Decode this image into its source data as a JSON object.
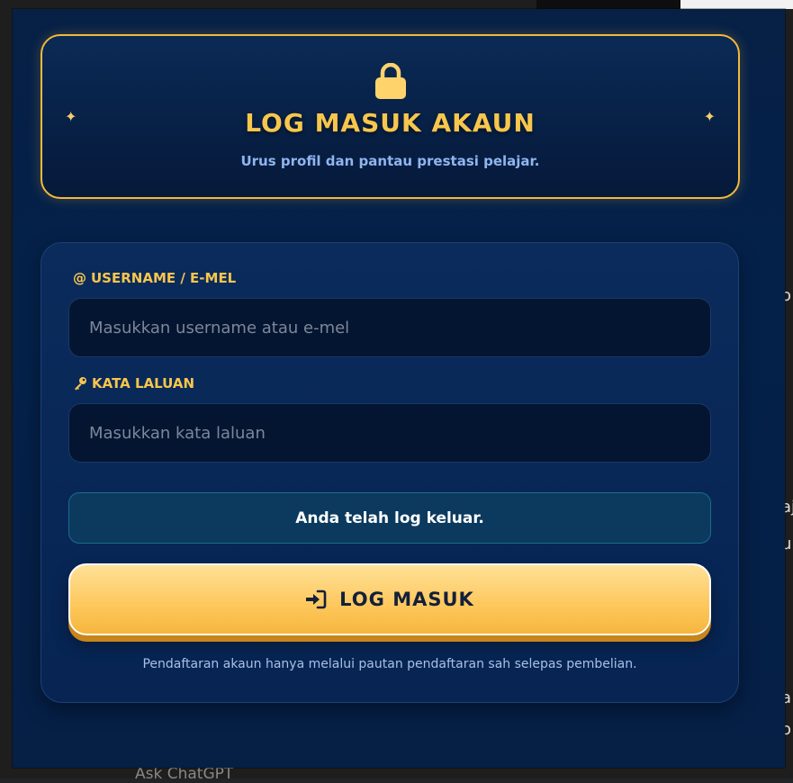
{
  "header": {
    "title": "LOG MASUK AKAUN",
    "subtitle": "Urus profil dan pantau prestasi pelajar.",
    "lock_icon": "lock-icon",
    "sparkle_icon": "sparkle-icon",
    "sparkle_char": "✦"
  },
  "form": {
    "username_label": "USERNAME / E-MEL",
    "username_icon_char": "@",
    "username_placeholder": "Masukkan username atau e-mel",
    "username_value": "",
    "password_label": "KATA LALUAN",
    "password_icon_char": "🔑",
    "password_placeholder": "Masukkan kata laluan",
    "password_value": "",
    "status_message": "Anda telah log keluar.",
    "submit_label": "LOG MASUK",
    "submit_icon": "sign-in-icon",
    "footnote": "Pendaftaran akaun hanya melalui pautan pendaftaran sah selepas pembelian."
  },
  "colors": {
    "accent_gold": "#f7c64d",
    "modal_bg": "#062046",
    "status_bg": "#0b3a5e",
    "button_gold": "#fdc75b"
  },
  "background_page": {
    "bottom_text": "Ask ChatGPT",
    "right_fragments": [
      "o",
      "aj",
      "u",
      "a",
      "o"
    ]
  }
}
